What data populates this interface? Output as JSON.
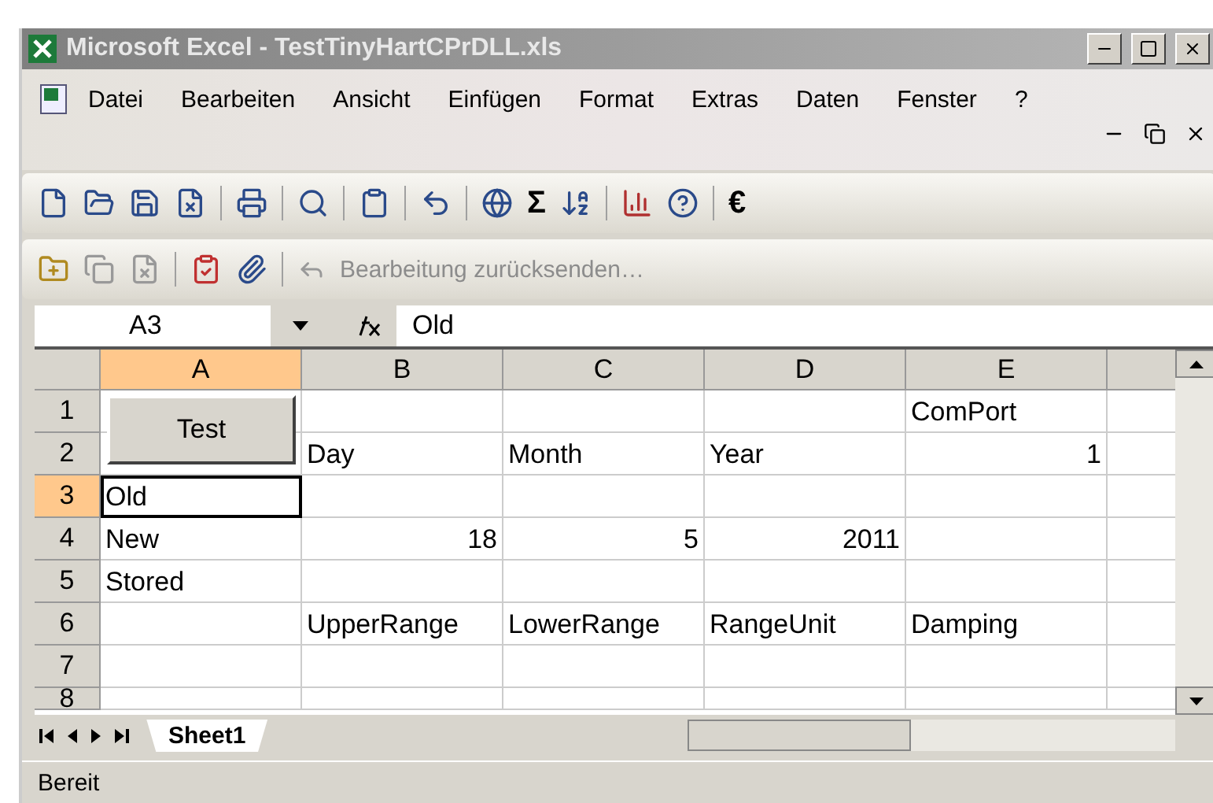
{
  "window": {
    "title": "Microsoft Excel - TestTinyHartCPrDLL.xls"
  },
  "menu": [
    "Datei",
    "Bearbeiten",
    "Ansicht",
    "Einfügen",
    "Format",
    "Extras",
    "Daten",
    "Fenster",
    "?"
  ],
  "toolbar": {
    "sum": "Σ",
    "euro": "€"
  },
  "toolbar2": {
    "label": "Bearbeitung zurücksenden…",
    "disabled": true
  },
  "formula_bar": {
    "name_box": "A3",
    "value": "Old"
  },
  "sheet": {
    "columns": [
      {
        "label": "A",
        "selected": true
      },
      {
        "label": "B",
        "selected": false
      },
      {
        "label": "C",
        "selected": false
      },
      {
        "label": "D",
        "selected": false
      },
      {
        "label": "E",
        "selected": false
      }
    ],
    "button": {
      "label": "Test"
    },
    "rows": [
      {
        "header": "1",
        "selected": false,
        "cells": [
          {
            "kind": "empty",
            "selected": false
          },
          {
            "kind": "empty",
            "selected": false
          },
          {
            "kind": "empty",
            "selected": false
          },
          {
            "kind": "empty",
            "selected": false
          },
          {
            "kind": "text",
            "text": "ComPort",
            "selected": false
          }
        ]
      },
      {
        "header": "2",
        "selected": false,
        "cells": [
          {
            "kind": "empty",
            "selected": false
          },
          {
            "kind": "text",
            "text": "Day",
            "selected": false
          },
          {
            "kind": "text",
            "text": "Month",
            "selected": false
          },
          {
            "kind": "text",
            "text": "Year",
            "selected": false
          },
          {
            "kind": "number",
            "text": "1",
            "selected": false
          }
        ]
      },
      {
        "header": "3",
        "selected": true,
        "cells": [
          {
            "kind": "text",
            "text": "Old",
            "selected": true
          },
          {
            "kind": "empty",
            "selected": false
          },
          {
            "kind": "empty",
            "selected": false
          },
          {
            "kind": "empty",
            "selected": false
          },
          {
            "kind": "empty",
            "selected": false
          }
        ]
      },
      {
        "header": "4",
        "selected": false,
        "cells": [
          {
            "kind": "text",
            "text": "New",
            "selected": false
          },
          {
            "kind": "number",
            "text": "18",
            "selected": false
          },
          {
            "kind": "number",
            "text": "5",
            "selected": false
          },
          {
            "kind": "number",
            "text": "2011",
            "selected": false
          },
          {
            "kind": "empty",
            "selected": false
          }
        ]
      },
      {
        "header": "5",
        "selected": false,
        "cells": [
          {
            "kind": "text",
            "text": "Stored",
            "selected": false
          },
          {
            "kind": "empty",
            "selected": false
          },
          {
            "kind": "empty",
            "selected": false
          },
          {
            "kind": "empty",
            "selected": false
          },
          {
            "kind": "empty",
            "selected": false
          }
        ]
      },
      {
        "header": "6",
        "selected": false,
        "cells": [
          {
            "kind": "empty",
            "selected": false
          },
          {
            "kind": "text",
            "text": "UpperRange",
            "selected": false
          },
          {
            "kind": "text",
            "text": "LowerRange",
            "selected": false
          },
          {
            "kind": "text",
            "text": "RangeUnit",
            "selected": false
          },
          {
            "kind": "text",
            "text": "Damping",
            "selected": false
          }
        ]
      },
      {
        "header": "7",
        "selected": false,
        "cells": [
          {
            "kind": "empty",
            "selected": false
          },
          {
            "kind": "empty",
            "selected": false
          },
          {
            "kind": "empty",
            "selected": false
          },
          {
            "kind": "empty",
            "selected": false
          },
          {
            "kind": "empty",
            "selected": false
          }
        ]
      },
      {
        "header": "8",
        "selected": false,
        "cells": [
          {
            "kind": "empty",
            "selected": false
          },
          {
            "kind": "empty",
            "selected": false
          },
          {
            "kind": "empty",
            "selected": false
          },
          {
            "kind": "empty",
            "selected": false
          },
          {
            "kind": "empty",
            "selected": false
          }
        ]
      }
    ],
    "tabs": [
      {
        "label": "Sheet1",
        "selected": true
      }
    ]
  },
  "status_bar": {
    "text": "Bereit"
  }
}
